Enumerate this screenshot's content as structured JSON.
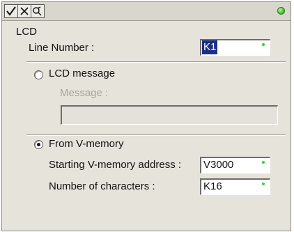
{
  "toolbar": {
    "buttons": [
      {
        "icon": "checkmark-icon"
      },
      {
        "icon": "cancel-x-icon"
      },
      {
        "icon": "help-icon"
      }
    ],
    "status_color": "#4ec63a"
  },
  "section_title": "LCD",
  "line_number": {
    "label": "Line Number :",
    "value": "K1"
  },
  "lcd_message": {
    "option_label": "LCD message",
    "selected": false,
    "message_label": "Message :",
    "message_value": ""
  },
  "from_vmemory": {
    "option_label": "From V-memory",
    "selected": true,
    "start_address_label": "Starting V-memory address :",
    "start_address_value": "V3000",
    "num_chars_label": "Number of characters :",
    "num_chars_value": "K16"
  }
}
